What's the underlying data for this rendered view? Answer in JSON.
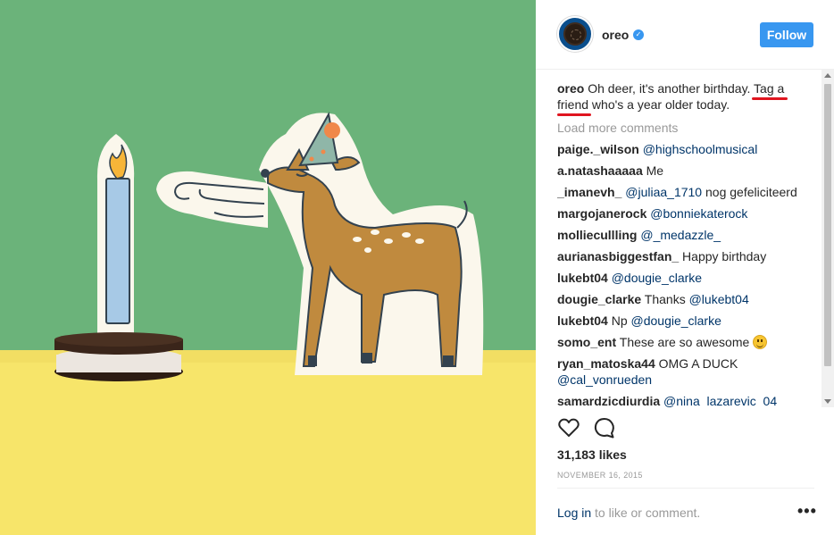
{
  "post": {
    "image_alt": "Paper cut-out deer in a party hat blowing toward a candle on a stack of sandwich cookies",
    "colors": {
      "background_green": "#6bb37a",
      "table_yellow": "#f7e56a",
      "deer_brown": "#c08a3e"
    }
  },
  "header": {
    "username": "oreo",
    "verified_icon": "verified-badge-icon",
    "follow_label": "Follow",
    "colors": {
      "follow_button": "#3897f0"
    }
  },
  "caption": {
    "username": "oreo",
    "text_before": " Oh deer, it's another birthday.",
    "tag_text": " Tag a friend",
    "text_after": " who's a year older today."
  },
  "load_more_label": "Load more comments",
  "comments": [
    {
      "user": "paige._wilson",
      "mention": "@highschoolmusical",
      "text": ""
    },
    {
      "user": "a.natashaaaaa",
      "mention": "",
      "text": " Me"
    },
    {
      "user": "_imanevh_",
      "mention": "@juliaa_1710",
      "text": " nog gefeliciteerd"
    },
    {
      "user": "margojanerock",
      "mention": "@bonniekaterock",
      "text": ""
    },
    {
      "user": "molliecullling",
      "mention": "@_medazzle_",
      "text": ""
    },
    {
      "user": "aurianasbiggestfan_",
      "mention": "",
      "text": " Happy birthday"
    },
    {
      "user": "lukebt04",
      "mention": "@dougie_clarke",
      "text": ""
    },
    {
      "user": "dougie_clarke",
      "mention": "@lukebt04",
      "text": " Thanks"
    },
    {
      "user": "lukebt04",
      "mention": "@dougie_clarke",
      "text": " Np"
    },
    {
      "user": "somo_ent",
      "mention": "",
      "text": " These are so awesome",
      "emoji": "smiling-face-emoji"
    },
    {
      "user": "ryan_matoska44",
      "mention": "@cal_vonrueden",
      "text": " OMG A DUCK"
    },
    {
      "user": "samardzicdiurdia",
      "mention": "@nina_lazarevic_04",
      "text": ""
    }
  ],
  "actions": {
    "like_icon": "heart-icon",
    "comment_icon": "comment-bubble-icon"
  },
  "likes": "31,183 likes",
  "date": "NOVEMBER 16, 2015",
  "login": {
    "link": "Log in",
    "text": " to like or comment."
  },
  "more_label": "•••"
}
